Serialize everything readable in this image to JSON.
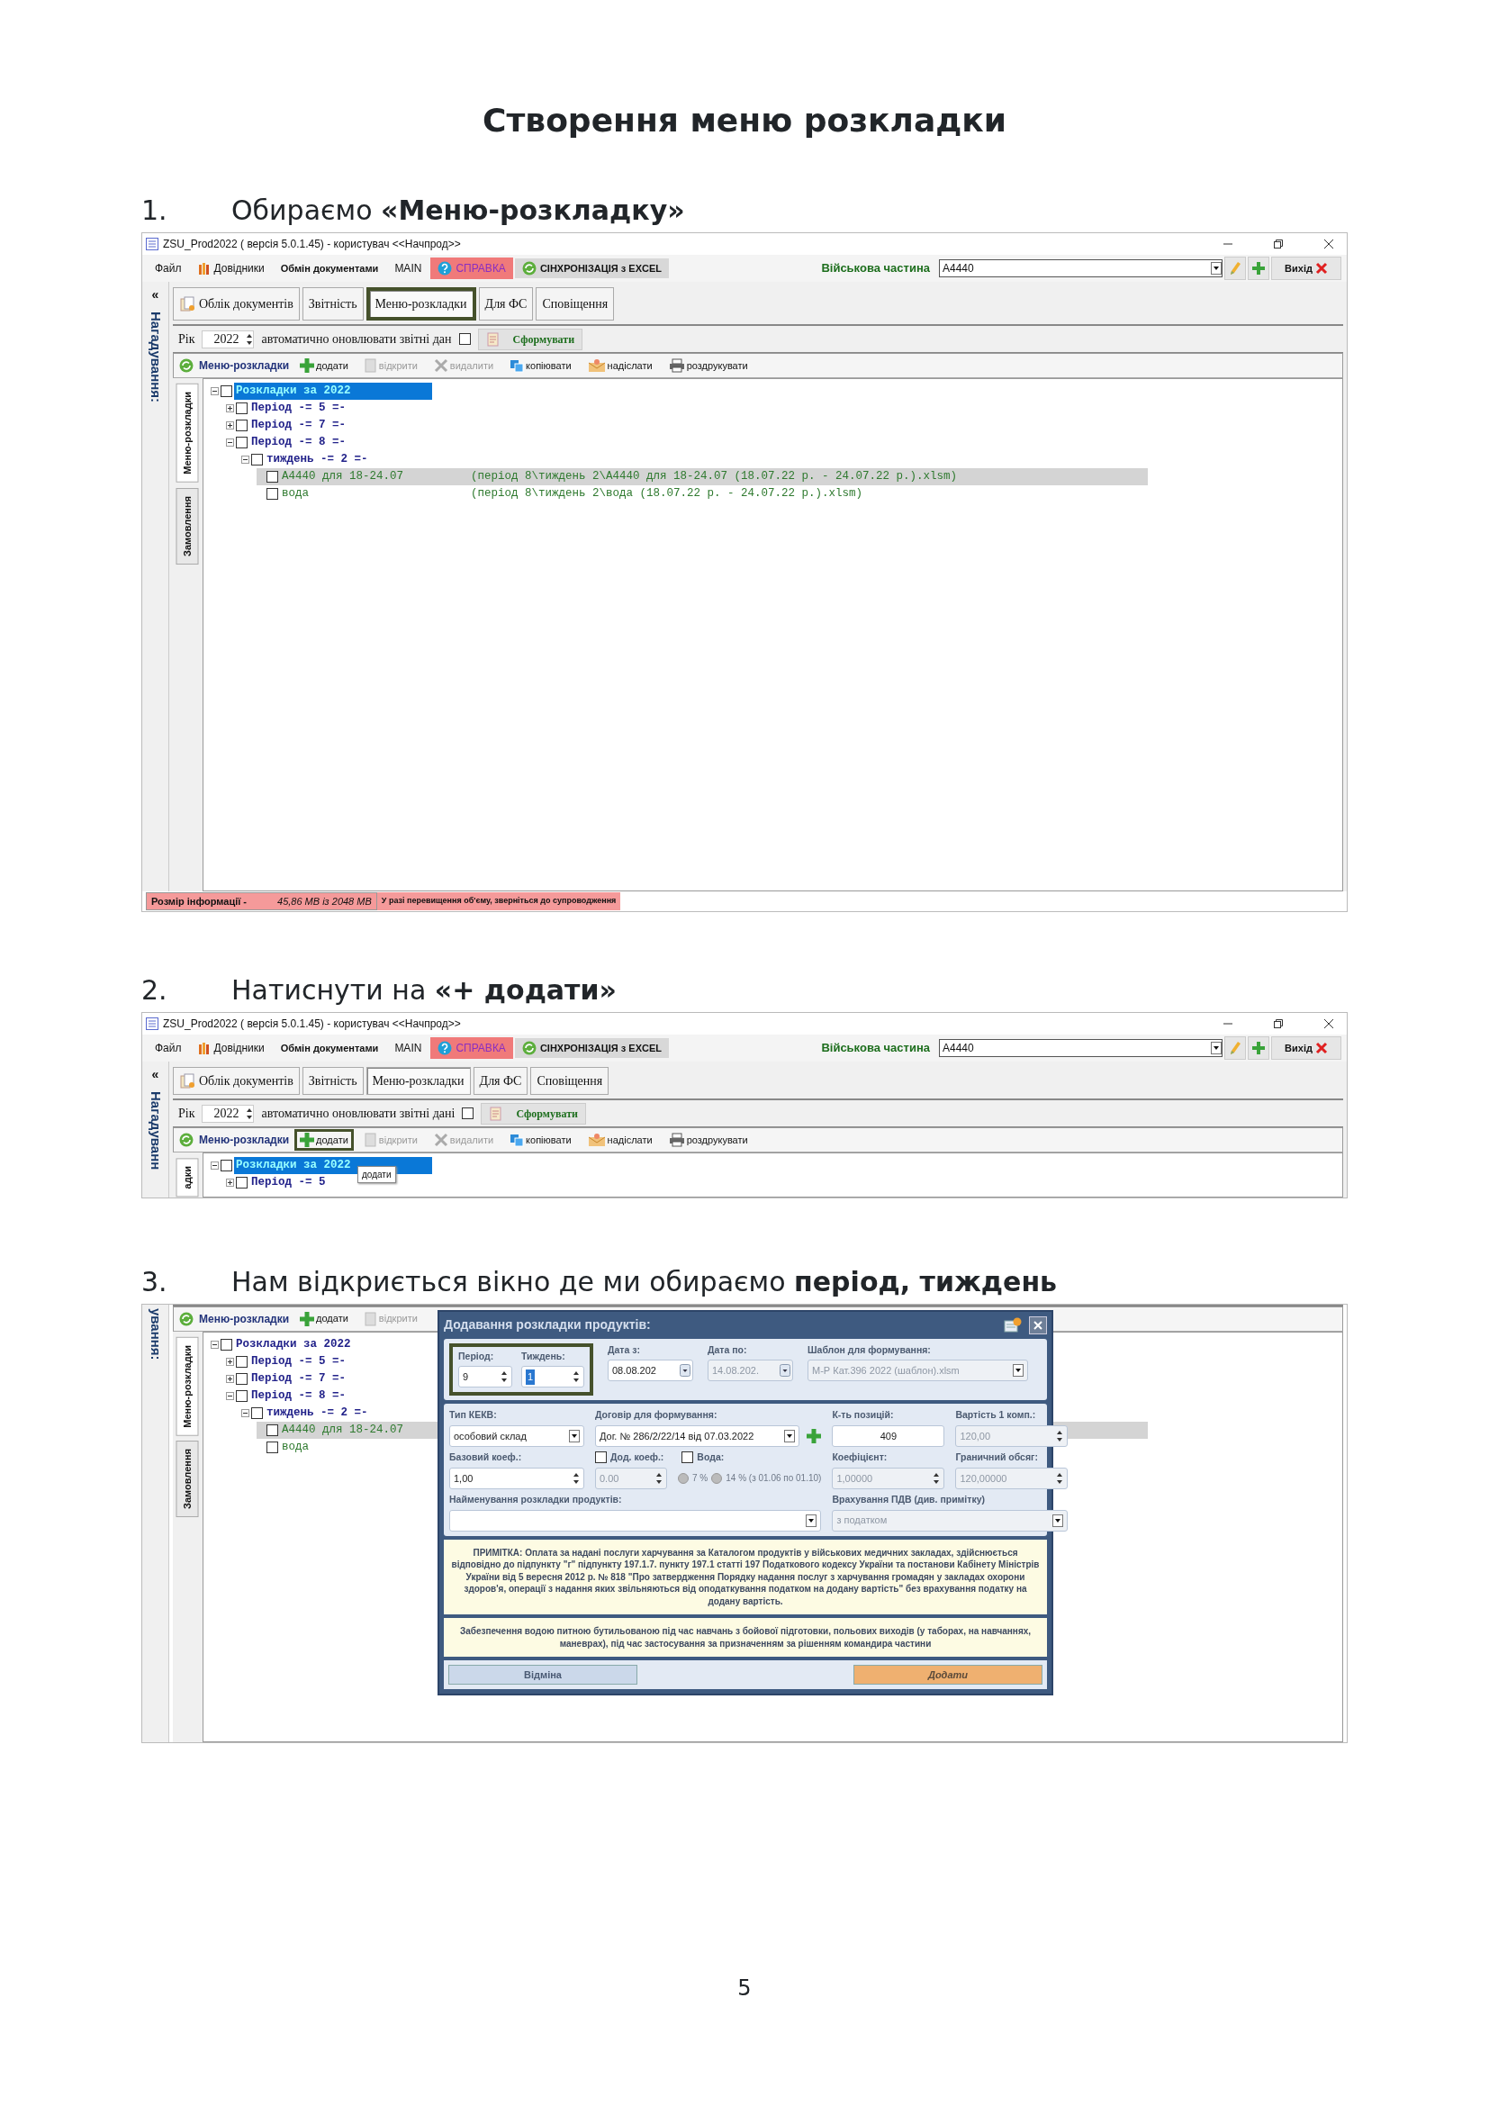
{
  "title": "Створення меню розкладки",
  "sections": [
    {
      "number": "1.",
      "text": "Обираємо **«Меню-розкладку»**",
      "screen": {
        "titlebar": {
          "title": "ZSU_Prod2022 ( версія 5.0.1.45)  - користувач <<Начпрод>>"
        },
        "menu": [
          {
            "label": "Файл",
            "kind": "plain"
          },
          {
            "label": "Довідники",
            "kind": "books"
          },
          {
            "label": "Обмін документами",
            "kind": "bold"
          },
          {
            "label": "MAIN",
            "kind": "plain"
          },
          {
            "label": "СПРАВКА",
            "kind": "help"
          },
          {
            "label": "СІНХРОНІЗАЦІЯ з EXCEL",
            "kind": "sync"
          }
        ],
        "unit": {
          "label": "Військова частина",
          "value": "А4440",
          "exit": "Вихід"
        },
        "reminder": {
          "arrow": "«",
          "label": "Нагадування:"
        },
        "tabs": [
          {
            "label": "Облік документів",
            "selected": false,
            "outlined": false
          },
          {
            "label": "Звітність",
            "selected": false,
            "outlined": false
          },
          {
            "label": "Меню-розкладки",
            "selected": true,
            "outlined": true
          },
          {
            "label": "Для ФС",
            "selected": false,
            "outlined": false
          },
          {
            "label": "Сповіщення",
            "selected": false,
            "outlined": false
          }
        ],
        "filter": {
          "year_label": "Рік",
          "year": "2022",
          "auto_label": "автоматично оновлювати звітні дан",
          "auto_checked": false,
          "build": "Сформувати"
        },
        "toolbar": {
          "title": "Меню-розкладки",
          "tools": [
            {
              "label": "додати",
              "kind": "add",
              "disabled": false,
              "outlined": false
            },
            {
              "label": "відкрити",
              "kind": "open",
              "disabled": true,
              "outlined": false
            },
            {
              "label": "видалити",
              "kind": "delete",
              "disabled": true,
              "outlined": false
            },
            {
              "label": "копіювати",
              "kind": "copy",
              "disabled": false,
              "outlined": false
            },
            {
              "label": "надіслати",
              "kind": "send",
              "disabled": false,
              "outlined": false
            },
            {
              "label": "роздрукувати",
              "kind": "print",
              "disabled": false,
              "outlined": false
            }
          ]
        },
        "side_tabs": [
          {
            "label": "Меню-розкладки",
            "selected": true
          },
          {
            "label": "Замовлення",
            "selected": false
          }
        ],
        "tree": [
          {
            "label": "Розкладки за 2022",
            "checked": false,
            "selected": true,
            "highlighted": false,
            "expanded": true,
            "children": [
              {
                "label": "Період -= 5 =-",
                "checked": false,
                "selected": false,
                "highlighted": false,
                "expanded": false
              },
              {
                "label": "Період -= 7 =-",
                "checked": false,
                "selected": false,
                "highlighted": false,
                "expanded": false
              },
              {
                "label": "Період -= 8 =-",
                "checked": false,
                "selected": false,
                "highlighted": false,
                "expanded": true,
                "children": [
                  {
                    "label": "тиждень -= 2 =-",
                    "checked": false,
                    "selected": false,
                    "highlighted": false,
                    "expanded": true,
                    "children": [
                      {
                        "label": "А4440 для 18-24.07",
                        "path": "(період 8\\тиждень 2\\А4440 для 18-24.07  (18.07.22 р. - 24.07.22 р.).xlsm)",
                        "checked": false,
                        "selected": false,
                        "highlighted": true
                      },
                      {
                        "label": "вода",
                        "path": "(період 8\\тиждень 2\\вода  (18.07.22 р. - 24.07.22 р.).xlsm)",
                        "checked": false,
                        "selected": false,
                        "highlighted": false
                      }
                    ]
                  }
                ]
              }
            ]
          }
        ],
        "status": {
          "label": "Розмір інформації -",
          "size": "45,86 MB із 2048 MB",
          "warning": "У разі перевищення об'єму, зверніться до супроводження"
        }
      }
    },
    {
      "number": "2.",
      "text": "Натиснути на **«+ додати»**",
      "screen": {
        "titlebar": {
          "title": "ZSU_Prod2022 ( версія 5.0.1.45)  - користувач <<Начпрод>>"
        },
        "menu": [
          {
            "label": "Файл",
            "kind": "plain"
          },
          {
            "label": "Довідники",
            "kind": "books"
          },
          {
            "label": "Обмін документами",
            "kind": "bold"
          },
          {
            "label": "MAIN",
            "kind": "plain"
          },
          {
            "label": "СПРАВКА",
            "kind": "help"
          },
          {
            "label": "СІНХРОНІЗАЦІЯ з EXCEL",
            "kind": "sync"
          }
        ],
        "unit": {
          "label": "Військова частина",
          "value": "А4440",
          "exit": "Вихід"
        },
        "reminder": {
          "arrow": "«",
          "label": "Нагадуванн"
        },
        "tabs": [
          {
            "label": "Облік документів",
            "selected": false,
            "outlined": false
          },
          {
            "label": "Звітність",
            "selected": false,
            "outlined": false
          },
          {
            "label": "Меню-розкладки",
            "selected": true,
            "outlined": false
          },
          {
            "label": "Для ФС",
            "selected": false,
            "outlined": false
          },
          {
            "label": "Сповіщення",
            "selected": false,
            "outlined": false
          }
        ],
        "filter": {
          "year_label": "Рік",
          "year": "2022",
          "auto_label": "автоматично оновлювати звітні дані",
          "auto_checked": false,
          "build": "Сформувати"
        },
        "toolbar": {
          "title": "Меню-розкладки",
          "tooltip": "додати",
          "tools": [
            {
              "label": "додати",
              "kind": "add",
              "disabled": false,
              "outlined": true
            },
            {
              "label": "відкрити",
              "kind": "open",
              "disabled": true,
              "outlined": false
            },
            {
              "label": "видалити",
              "kind": "delete",
              "disabled": true,
              "outlined": false
            },
            {
              "label": "копіювати",
              "kind": "copy",
              "disabled": false,
              "outlined": false
            },
            {
              "label": "надіслати",
              "kind": "send",
              "disabled": false,
              "outlined": false
            },
            {
              "label": "роздрукувати",
              "kind": "print",
              "disabled": false,
              "outlined": false
            }
          ]
        },
        "side_tabs": [
          {
            "label": "адки",
            "selected": true
          }
        ],
        "tree": [
          {
            "label": "Розкладки за 2022",
            "checked": false,
            "selected": true,
            "highlighted": false,
            "expanded": true,
            "children": [
              {
                "label": "Період -= 5",
                "checked": false,
                "selected": false,
                "highlighted": false,
                "expanded": false
              }
            ]
          }
        ]
      }
    },
    {
      "number": "3.",
      "text": "Нам відкриється вікно де ми обираємо **період, тиждень**",
      "screen": {
        "reminder": {
          "label": "ування:"
        },
        "toolbar": {
          "title": "Меню-розкладки",
          "tools": [
            {
              "label": "додати",
              "kind": "add",
              "disabled": false,
              "outlined": false
            },
            {
              "label": "відкрити",
              "kind": "open",
              "disabled": true,
              "outlined": false
            }
          ]
        },
        "side_tabs": [
          {
            "label": "Меню-розкладки",
            "selected": true
          },
          {
            "label": "Замовлення",
            "selected": false
          }
        ],
        "tree": [
          {
            "label": "Розкладки за 2022",
            "checked": false,
            "selected": false,
            "highlighted": false,
            "expanded": true,
            "children": [
              {
                "label": "Період -= 5 =-",
                "checked": false,
                "selected": false,
                "highlighted": false,
                "expanded": false
              },
              {
                "label": "Період -= 7 =-",
                "checked": false,
                "selected": false,
                "highlighted": false,
                "expanded": false
              },
              {
                "label": "Період -= 8 =-",
                "checked": false,
                "selected": false,
                "highlighted": false,
                "expanded": true,
                "children": [
                  {
                    "label": "тиждень -= 2 =-",
                    "checked": false,
                    "selected": false,
                    "highlighted": false,
                    "expanded": true,
                    "children": [
                      {
                        "label": "А4440 для 18-24.07",
                        "checked": false,
                        "selected": false,
                        "highlighted": true
                      },
                      {
                        "label": "вода",
                        "checked": false,
                        "selected": false,
                        "highlighted": false
                      }
                    ]
                  }
                ]
              }
            ]
          }
        ],
        "dialog": {
          "title": "Додавання розкладки продуктів:",
          "framed_fields": [
            {
              "kind": "spin",
              "label": "Період:",
              "value": "9",
              "disabled": false,
              "value_selected": false
            },
            {
              "kind": "spin",
              "label": "Тиждень:",
              "value": "1",
              "disabled": false,
              "value_selected": true
            }
          ],
          "top_fields": [
            {
              "kind": "date",
              "label": "Дата з:",
              "value": "08.08.202",
              "disabled": false
            },
            {
              "kind": "date",
              "label": "Дата по:",
              "value": "14.08.202.",
              "disabled": true
            },
            {
              "kind": "combo",
              "label": "Шаблон для формування:",
              "value": "М-Р Кат.396 2022 (шаблон).xlsm",
              "disabled": true
            }
          ],
          "rows": [
            [
              {
                "kind": "combo",
                "label": "Тип КЕКВ:",
                "value": "особовий склад",
                "disabled": false
              },
              {
                "kind": "combo_add",
                "label": "Договір для формування:",
                "value": "Дог. № 286/2/22/14 від 07.03.2022",
                "disabled": false
              },
              {
                "kind": "number",
                "label": "К-ть позицій:",
                "value": "409",
                "disabled": false
              },
              {
                "kind": "spin",
                "label": "Вартість 1 комп.:",
                "value": "120,00",
                "disabled": true
              }
            ],
            [
              {
                "kind": "spin",
                "label": "Базовий коеф.:",
                "value": "1,00",
                "disabled": false
              },
              {
                "kind": "extras",
                "coef": {
                  "label": "Дод. коеф.:",
                  "checked": false,
                  "value": "0.00",
                  "disabled": true
                },
                "water": {
                  "label": "Вода:",
                  "checked": false,
                  "disabled": true,
                  "options": [
                    {
                      "label": "7 %",
                      "selected": false
                    },
                    {
                      "label": "14 % (з 01.06 по 01.10)",
                      "selected": false
                    }
                  ]
                }
              },
              {
                "kind": "spin",
                "label": "Коефіцієнт:",
                "value": "1,00000",
                "disabled": true
              },
              {
                "kind": "spin",
                "label": "Граничний обсяг:",
                "value": "120,00000",
                "disabled": true
              }
            ]
          ],
          "name_field": {
            "kind": "combo",
            "label": "Найменування розкладки продуктів:",
            "disabled": false
          },
          "vat_field": {
            "kind": "combo",
            "label": "Врахування ПДВ (див. примітку)",
            "value": "з податком",
            "disabled": true
          },
          "notes": [
            "ПРИМІТКА: Оплата за надані послуги харчування за Каталогом продуктів у військових медичних закладах, здійснюється відповідно до підпункту \"г\" підпункту 197.1.7. пункту 197.1 статті 197 Податкового кодексу України та постанови Кабінету Міністрів України від  5 вересня 2012 р. № 818 \"Про затвердження Порядку надання послуг з харчування громадян у закладах охорони здоров'я, операції з надання яких звільняються від оподаткування податком на додану вартість\" без врахування податку на додану вартість.",
            "Забезпечення водою питною бутильованою під час навчань з бойової підготовки, польових виходів (у таборах, на навчаннях, маневрах), під час застосування за призначенням за рішенням командира частини"
          ],
          "buttons": [
            {
              "label": "Відміна",
              "kind": "cancel"
            },
            {
              "label": "Додати",
              "kind": "primary"
            }
          ]
        }
      }
    }
  ],
  "page_number": "5"
}
